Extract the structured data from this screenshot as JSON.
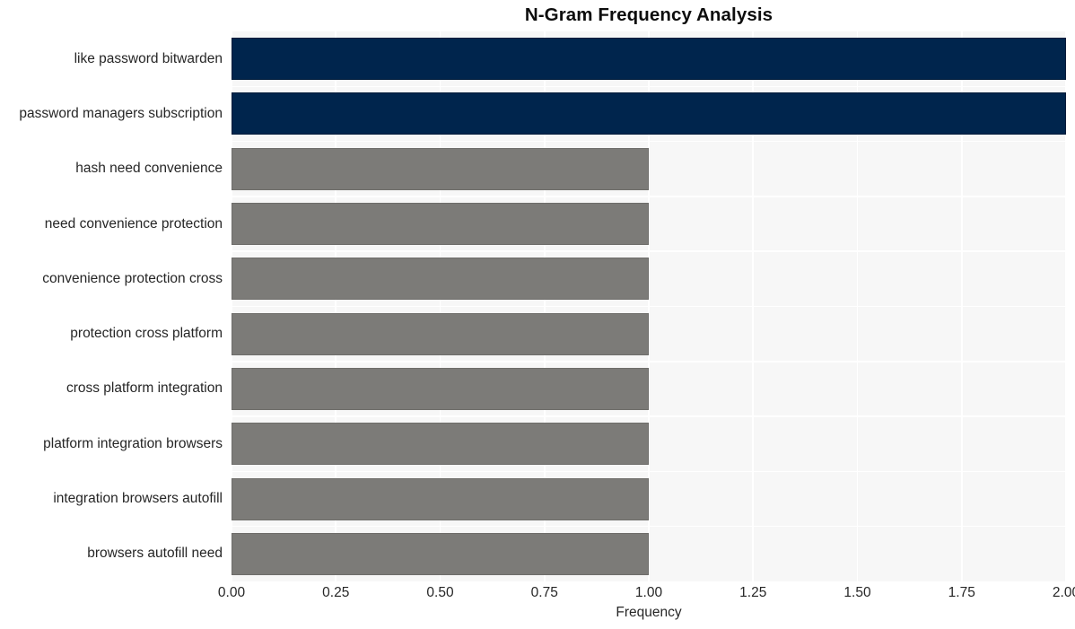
{
  "chart_data": {
    "type": "bar",
    "orientation": "horizontal",
    "title": "N-Gram Frequency Analysis",
    "xlabel": "Frequency",
    "ylabel": "",
    "categories": [
      "like password bitwarden",
      "password managers subscription",
      "hash need convenience",
      "need convenience protection",
      "convenience protection cross",
      "protection cross platform",
      "cross platform integration",
      "platform integration browsers",
      "integration browsers autofill",
      "browsers autofill need"
    ],
    "values": [
      2,
      2,
      1,
      1,
      1,
      1,
      1,
      1,
      1,
      1
    ],
    "bar_colors": [
      "#00254d",
      "#00254d",
      "#7c7b78",
      "#7c7b78",
      "#7c7b78",
      "#7c7b78",
      "#7c7b78",
      "#7c7b78",
      "#7c7b78",
      "#7c7b78"
    ],
    "xlim": [
      0,
      2
    ],
    "xticks": [
      0,
      0.25,
      0.5,
      0.75,
      1,
      1.25,
      1.5,
      1.75,
      2
    ],
    "xticklabels": [
      "0.00",
      "0.25",
      "0.50",
      "0.75",
      "1.00",
      "1.25",
      "1.50",
      "1.75",
      "2.00"
    ],
    "grid": true,
    "grid_color": "#ffffff",
    "plot_background": "#f7f7f7",
    "figure_background": "#ffffff",
    "legend": null,
    "highlight_color": "#00254d",
    "default_color": "#7c7b78"
  }
}
